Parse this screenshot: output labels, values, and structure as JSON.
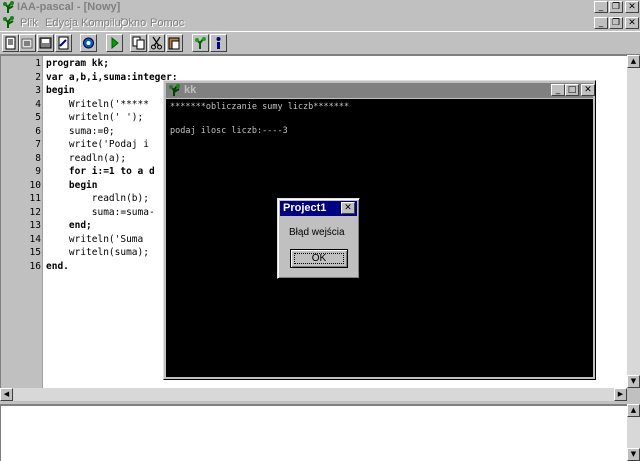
{
  "app": {
    "title": "IAA-pascal - [Nowy]"
  },
  "menu": {
    "items": [
      "Plik",
      "Edycja",
      "Kompiluj",
      "Okno",
      "Pomoc"
    ]
  },
  "window_buttons": {
    "minimize": "_",
    "restore": "❐",
    "close": "✕"
  },
  "toolbar": {
    "icons": [
      "new-file-icon",
      "open-file-icon",
      "save-icon",
      "save-as-icon",
      "print-icon",
      "run-icon",
      "copy-icon",
      "cut-icon",
      "paste-icon",
      "compile-icon",
      "info-icon"
    ]
  },
  "editor": {
    "lines": [
      {
        "no": "1",
        "text": "program kk;"
      },
      {
        "no": "2",
        "text": "var a,b,i,suma:integer;"
      },
      {
        "no": "3",
        "text": "begin"
      },
      {
        "no": "4",
        "text": "    Writeln('*****"
      },
      {
        "no": "5",
        "text": "    writeln(' ');"
      },
      {
        "no": "6",
        "text": "    suma:=0;"
      },
      {
        "no": "7",
        "text": "    write('Podaj i"
      },
      {
        "no": "8",
        "text": "    readln(a);"
      },
      {
        "no": "9",
        "text": "    for i:=1 to a d"
      },
      {
        "no": "10",
        "text": "    begin"
      },
      {
        "no": "11",
        "text": "        readln(b);"
      },
      {
        "no": "12",
        "text": "        suma:=suma-"
      },
      {
        "no": "13",
        "text": "    end;"
      },
      {
        "no": "14",
        "text": "    writeln('Suma"
      },
      {
        "no": "15",
        "text": "    writeln(suma);"
      },
      {
        "no": "16",
        "text": "end."
      }
    ]
  },
  "console": {
    "title": "kk",
    "lines": [
      "*******obliczanie sumy liczb*******",
      "",
      "podaj ilosc liczb:----3"
    ]
  },
  "dialog": {
    "title": "Project1",
    "message": "Błąd wejścia",
    "ok_label": "OK",
    "close_label": "✕"
  },
  "colors": {
    "face": "#c0c0c0",
    "active_title": "#000080",
    "inactive_title": "#808080",
    "console_bg": "#000000",
    "console_text": "#c0c0c0"
  }
}
